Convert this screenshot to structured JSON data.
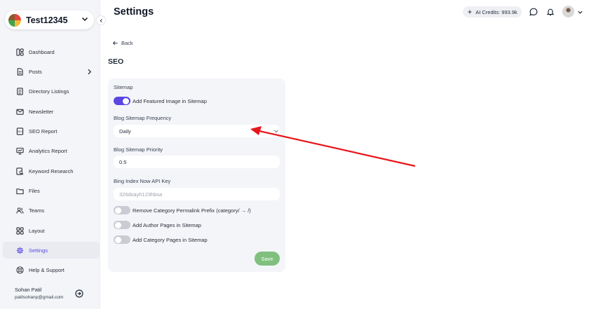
{
  "workspace": {
    "name": "Test12345"
  },
  "sidebar": {
    "items": [
      {
        "label": "Dashboard",
        "icon": "dashboard-icon"
      },
      {
        "label": "Posts",
        "icon": "document-icon",
        "has_children": true
      },
      {
        "label": "Directory Listings",
        "icon": "listing-icon"
      },
      {
        "label": "Newsletter",
        "icon": "mail-icon"
      },
      {
        "label": "SEO Report",
        "icon": "seo-report-icon"
      },
      {
        "label": "Analytics Report",
        "icon": "analytics-icon"
      },
      {
        "label": "Keyword Research",
        "icon": "keyword-search-icon"
      },
      {
        "label": "Files",
        "icon": "folder-icon"
      },
      {
        "label": "Teams",
        "icon": "users-icon"
      },
      {
        "label": "Layout",
        "icon": "layout-grid-icon"
      },
      {
        "label": "Settings",
        "icon": "gear-icon",
        "active": true
      },
      {
        "label": "Help & Support",
        "icon": "help-icon"
      }
    ],
    "user": {
      "name": "Sohan Patil",
      "email": "patilsohanp@gmail.com"
    }
  },
  "header": {
    "title": "Settings",
    "credits": "AI Credits: 993.9k"
  },
  "content": {
    "back_label": "Back",
    "section_title": "SEO",
    "sitemap_label": "Sitemap",
    "featured_image_toggle": {
      "label": "Add Featured Image in Sitemap",
      "on": true
    },
    "frequency": {
      "label": "Blog Sitemap Frequency",
      "value": "Daily"
    },
    "priority": {
      "label": "Blog Sitemap Priority",
      "value": "0.5"
    },
    "bing_key": {
      "label": "Bing Index Now API Key",
      "placeholder": "326dsayh123hbsa"
    },
    "toggles": [
      {
        "label": "Remove Category Permalink Prefix (category/ → /)",
        "on": false
      },
      {
        "label": "Add Author Pages in Sitemap",
        "on": false
      },
      {
        "label": "Add Category Pages in Sitemap",
        "on": false
      }
    ],
    "save_label": "Save"
  },
  "colors": {
    "accent": "#5b46e2",
    "save_button": "#7fc07f",
    "annotation_arrow": "#e8141b"
  }
}
